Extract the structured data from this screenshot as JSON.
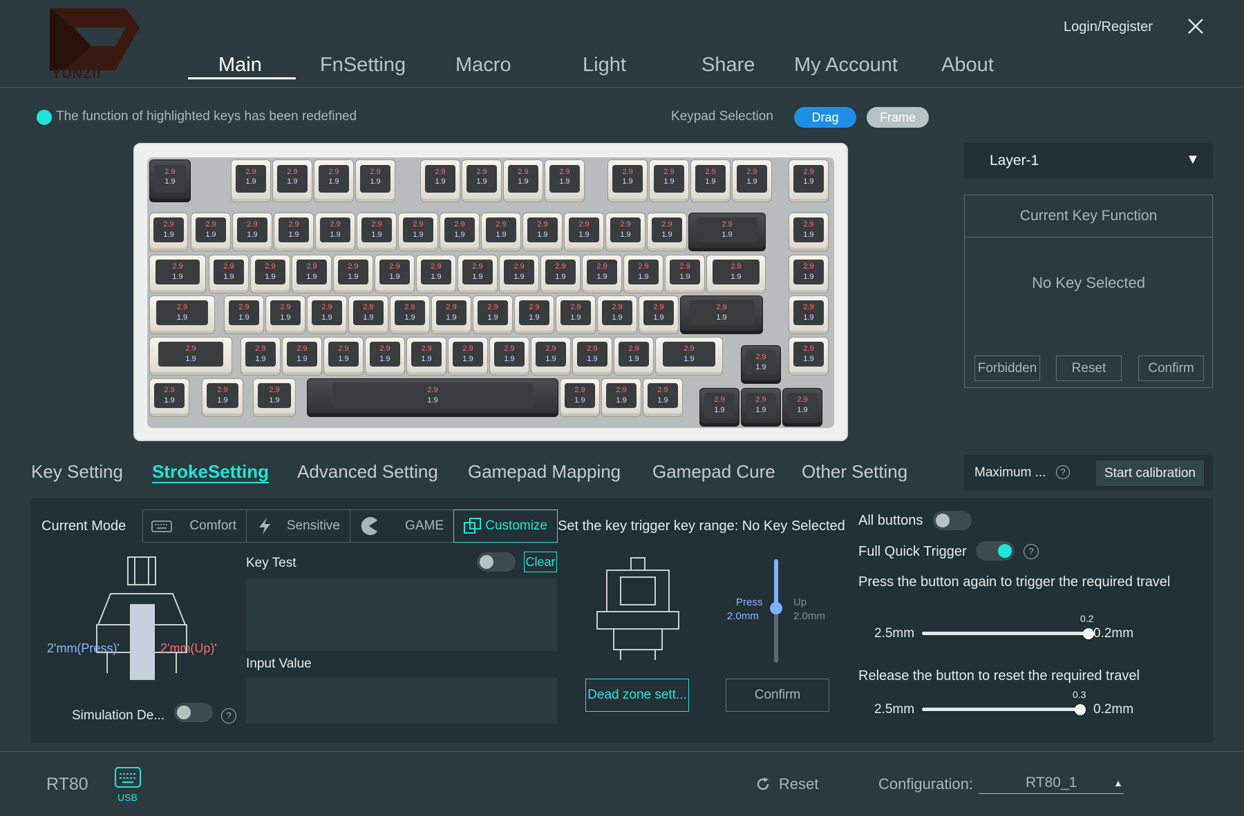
{
  "brand": {
    "logo_text": "YUNZII"
  },
  "nav": {
    "tabs": [
      {
        "label": "Main"
      },
      {
        "label": "FnSetting"
      },
      {
        "label": "Macro"
      },
      {
        "label": "Light"
      },
      {
        "label": "Share"
      },
      {
        "label": "My Account"
      },
      {
        "label": "About"
      }
    ],
    "active": "Main",
    "login": "Login/Register"
  },
  "info": {
    "highlight_text": "The function of highlighted keys has been redefined",
    "keypad_selection": "Keypad Selection",
    "drag": "Drag",
    "frame": "Frame"
  },
  "keyboard": {
    "press_value": "2.9",
    "release_value": "1.9"
  },
  "layer": {
    "selected": "Layer-1"
  },
  "current_key_function": {
    "title": "Current Key Function",
    "empty_text": "No Key Selected",
    "forbidden": "Forbidden",
    "reset": "Reset",
    "confirm": "Confirm"
  },
  "sub_tabs": [
    {
      "label": "Key Setting"
    },
    {
      "label": "StrokeSetting"
    },
    {
      "label": "Advanced Setting"
    },
    {
      "label": "Gamepad Mapping"
    },
    {
      "label": "Gamepad Cure"
    },
    {
      "label": "Other Setting"
    }
  ],
  "calibration": {
    "maximum": "Maximum ...",
    "start": "Start calibration"
  },
  "stroke": {
    "current_mode_label": "Current Mode",
    "modes": [
      {
        "label": "Comfort",
        "icon": "keyboard-icon"
      },
      {
        "label": "Sensitive",
        "icon": "lightning-icon"
      },
      {
        "label": "GAME",
        "icon": "pacman-icon"
      },
      {
        "label": "Customize",
        "icon": "customize-icon"
      }
    ],
    "active_mode": "Customize",
    "range_label": "Set the key trigger key range:  No Key Selected",
    "press_label": "2'mm(Press)'",
    "up_label": "2'mm(Up)'",
    "simulation_label": "Simulation De...",
    "key_test_label": "Key Test",
    "clear": "Clear",
    "input_value_label": "Input Value",
    "vertical_slider": {
      "press_label": "Press",
      "press_value": "2.0mm",
      "up_label": "Up",
      "up_value": "2.0mm"
    },
    "dead_zone": "Dead zone sett...",
    "confirm": "Confirm",
    "all_buttons": "All buttons",
    "full_quick_trigger": "Full Quick Trigger",
    "full_quick_trigger_on": true,
    "press_again_text": "Press the button again to trigger the required travel",
    "press_again_slider": {
      "min": "2.5mm",
      "max": "0.2mm",
      "value": "0.2"
    },
    "release_text": "Release the button to reset the required travel",
    "release_slider": {
      "min": "2.5mm",
      "max": "0.2mm",
      "value": "0.3"
    }
  },
  "footer": {
    "device": "RT80",
    "connection": "USB",
    "reset": "Reset",
    "configuration_label": "Configuration:",
    "configuration_value": "RT80_1"
  },
  "colors": {
    "accent": "#1fe5d4",
    "primary_button": "#1f8fe6",
    "background": "#2b3a3f",
    "panel": "#233035"
  }
}
